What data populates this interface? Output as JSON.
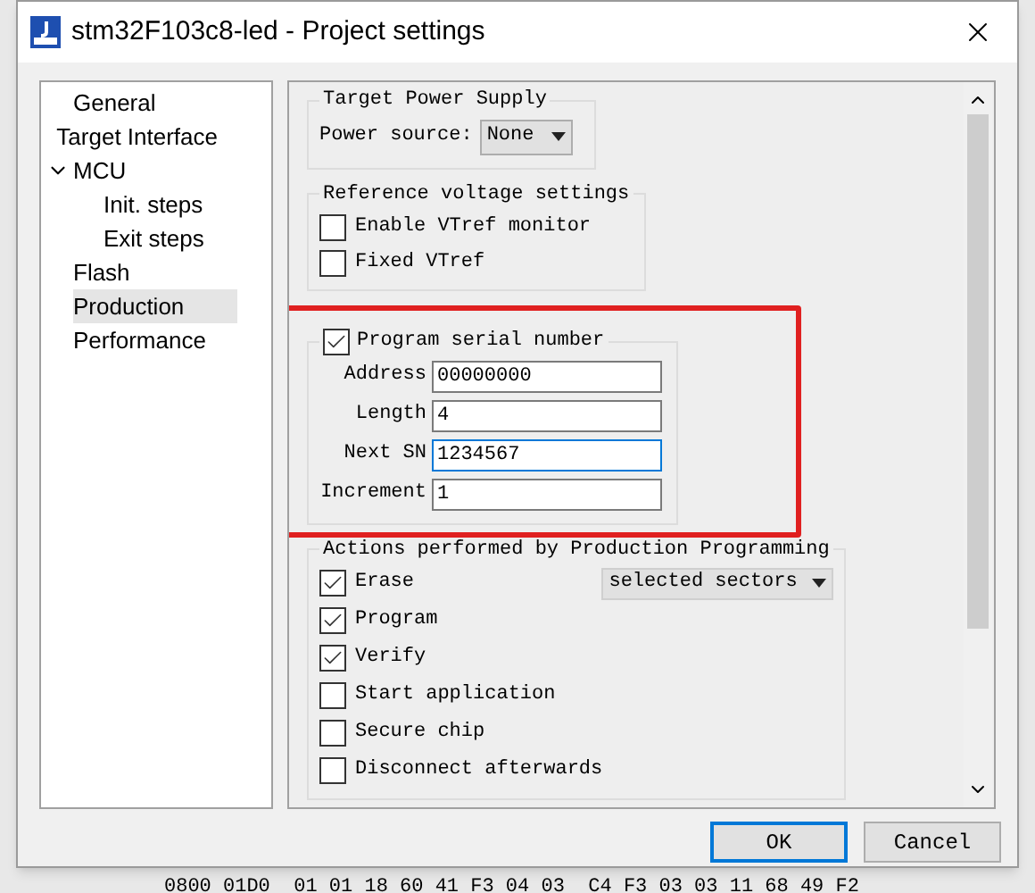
{
  "window": {
    "title": "stm32F103c8-led - Project settings"
  },
  "sidebar": {
    "items": [
      {
        "label": "General",
        "selected": false
      },
      {
        "label": "Target Interface",
        "selected": false
      },
      {
        "label": "MCU",
        "selected": false,
        "expanded": true,
        "children": [
          {
            "label": "Init. steps",
            "selected": false
          },
          {
            "label": "Exit steps",
            "selected": false
          }
        ]
      },
      {
        "label": "Flash",
        "selected": false
      },
      {
        "label": "Production",
        "selected": true
      },
      {
        "label": "Performance",
        "selected": false
      }
    ]
  },
  "power_supply": {
    "title": "Target Power Supply",
    "label": "Power source:",
    "value": "None"
  },
  "reference_voltage": {
    "title": "Reference voltage settings",
    "options": [
      {
        "label": "Enable VTref monitor",
        "checked": false
      },
      {
        "label": "Fixed VTref",
        "checked": false
      }
    ]
  },
  "serial_number": {
    "label": "Program serial number",
    "checked": true,
    "highlighted": true,
    "fields": [
      {
        "label": "Address",
        "value": "00000000",
        "focused": false
      },
      {
        "label": "Length",
        "value": "4",
        "focused": false
      },
      {
        "label": "Next SN",
        "value": "1234567",
        "focused": true
      },
      {
        "label": "Increment",
        "value": "1",
        "focused": false
      }
    ]
  },
  "actions": {
    "title": "Actions performed by  Production Programming",
    "options": [
      {
        "label": "Erase",
        "checked": true,
        "dropdown": "selected sectors"
      },
      {
        "label": "Program",
        "checked": true
      },
      {
        "label": "Verify",
        "checked": true
      },
      {
        "label": "Start application",
        "checked": false
      },
      {
        "label": "Secure chip",
        "checked": false
      },
      {
        "label": "Disconnect afterwards",
        "checked": false
      }
    ]
  },
  "buttons": [
    {
      "label": "OK",
      "default": true
    },
    {
      "label": "Cancel",
      "default": false
    }
  ],
  "background": {
    "hex_line": "0800 01D0  01 01 18 60 41 F3 04 03  C4 F3 03 03 11 68 49 F2"
  }
}
